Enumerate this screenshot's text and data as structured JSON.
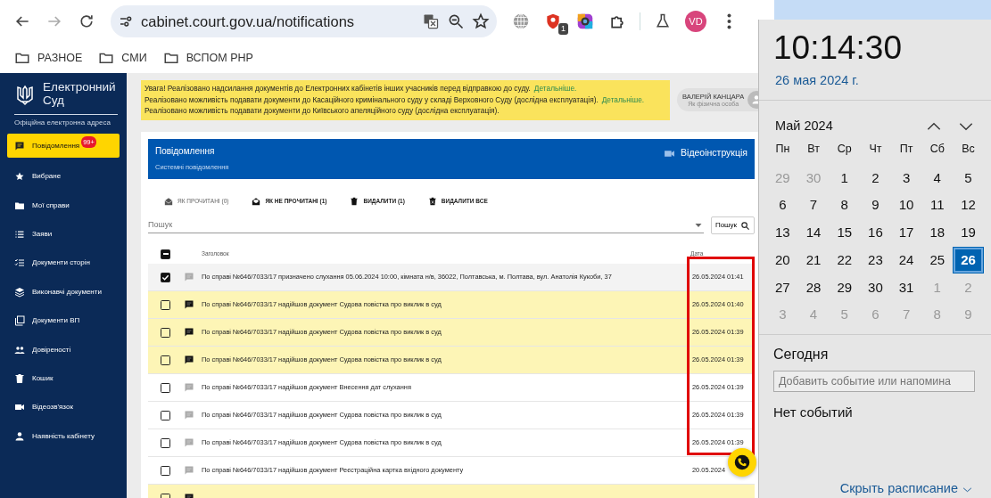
{
  "browser": {
    "url": "cabinet.court.gov.ua/notifications",
    "extension_badge": "1",
    "profile_initials": "VD",
    "bookmarks": [
      {
        "label": "РАЗНОЕ"
      },
      {
        "label": "СМИ"
      },
      {
        "label": "ВСПОМ PHP"
      }
    ]
  },
  "site": {
    "logo_title": "Електронний",
    "logo_title_2": "Суд",
    "logo_subtitle": "Офіційна електронна адреса"
  },
  "sidebar": {
    "items": [
      {
        "label": "Повідомлення",
        "kind": "message",
        "selected": true,
        "badge": "99+"
      },
      {
        "label": "Вибране",
        "kind": "star",
        "selected": false
      },
      {
        "label": "Мої справи",
        "kind": "folder",
        "selected": false
      },
      {
        "label": "Заяви",
        "kind": "list",
        "selected": false
      },
      {
        "label": "Документи сторін",
        "kind": "checklist",
        "selected": false
      },
      {
        "label": "Виконавчі документи",
        "kind": "layers",
        "selected": false
      },
      {
        "label": "Документи ВП",
        "kind": "copy",
        "selected": false
      },
      {
        "label": "Довіреності",
        "kind": "people",
        "selected": false
      },
      {
        "label": "Кошик",
        "kind": "trash",
        "selected": false
      },
      {
        "label": "Відеозв'язок",
        "kind": "video",
        "selected": false
      },
      {
        "label": "Наявність кабінету",
        "kind": "person",
        "selected": false
      }
    ]
  },
  "notice": {
    "lines": [
      {
        "text": "Увага! Реалізовано надсилання документів до Електронних кабінетів інших учасників перед відправкою до суду.",
        "link": "Детальніше."
      },
      {
        "text": "Реалізовано можливість подавати документи до Касаційного кримінального суду у складі Верховного Суду (дослідна експлуатація).",
        "link": "Детальніше."
      },
      {
        "text": "Реалізовано можливість подавати документи до Київського апеляційного суду (дослідна експлуатація)."
      }
    ]
  },
  "user": {
    "name": "ВАЛЕРІЙ КАНЦАРА",
    "role": "Як фізична особа"
  },
  "panel": {
    "title": "Повідомлення",
    "subtitle": "Системні повідомлення",
    "video_link": "Відеоінструкція"
  },
  "actions": [
    {
      "label": "ЯК ПРОЧИТАНІ (0)",
      "kind": "mailopen",
      "disabled": true
    },
    {
      "label": "ЯК НЕ ПРОЧИТАНІ (1)",
      "kind": "mail",
      "disabled": false
    },
    {
      "label": "ВИДАЛИТИ (1)",
      "kind": "trash",
      "disabled": false
    },
    {
      "label": "ВИДАЛИТИ ВСЕ",
      "kind": "trashall",
      "disabled": false
    }
  ],
  "search": {
    "placeholder": "Пошук",
    "button": "Пошук"
  },
  "table": {
    "select_all_indeterminate": true,
    "columns": [
      "Заголовок",
      "Дата"
    ],
    "rows": [
      {
        "checked": true,
        "unread": false,
        "highlighted": true,
        "title": "По справі №646/7033/17 призначено слухання 05.06.2024 10:00, кімната н/в, 36022, Полтавська, м. Полтава, вул. Анатолія Кукоби, 37",
        "date": "26.05.2024 01:41"
      },
      {
        "checked": false,
        "unread": true,
        "highlighted": true,
        "title": "По справі №646/7033/17 надійшов документ Судова повістка про виклик в суд",
        "date": "26.05.2024 01:40"
      },
      {
        "checked": false,
        "unread": true,
        "highlighted": true,
        "title": "По справі №646/7033/17 надійшов документ Судова повістка про виклик в суд",
        "date": "26.05.2024 01:39"
      },
      {
        "checked": false,
        "unread": true,
        "highlighted": true,
        "title": "По справі №646/7033/17 надійшов документ Судова повістка про виклик в суд",
        "date": "26.05.2024 01:39"
      },
      {
        "checked": false,
        "unread": false,
        "highlighted": true,
        "title": "По справі №646/7033/17 надійшов документ Внесення дат слухання",
        "date": "26.05.2024 01:39"
      },
      {
        "checked": false,
        "unread": false,
        "highlighted": true,
        "title": "По справі №646/7033/17 надійшов документ Судова повістка про виклик в суд",
        "date": "26.05.2024 01:39"
      },
      {
        "checked": false,
        "unread": false,
        "highlighted": true,
        "title": "По справі №646/7033/17 надійшов документ Судова повістка про виклик в суд",
        "date": "26.05.2024 01:39"
      },
      {
        "checked": false,
        "unread": false,
        "highlighted": false,
        "title": "По справі №646/7033/17 надійшов документ Реєстраційна картка вхідного документу",
        "date": "20.05.2024"
      },
      {
        "checked": false,
        "unread": true,
        "highlighted": false
      }
    ]
  },
  "clock": {
    "time": "10:14:30",
    "date": "26 мая 2024 г."
  },
  "calendar": {
    "month": "Май 2024",
    "weekdays": [
      "Пн",
      "Вт",
      "Ср",
      "Чт",
      "Пт",
      "Сб",
      "Вс"
    ],
    "days": [
      {
        "label": "29",
        "other_month": true,
        "selected": false
      },
      {
        "label": "30",
        "other_month": true,
        "selected": false
      },
      {
        "label": "1",
        "other_month": false,
        "selected": false
      },
      {
        "label": "2",
        "other_month": false,
        "selected": false
      },
      {
        "label": "3",
        "other_month": false,
        "selected": false
      },
      {
        "label": "4",
        "other_month": false,
        "selected": false
      },
      {
        "label": "5",
        "other_month": false,
        "selected": false
      },
      {
        "label": "6",
        "other_month": false,
        "selected": false
      },
      {
        "label": "7",
        "other_month": false,
        "selected": false
      },
      {
        "label": "8",
        "other_month": false,
        "selected": false
      },
      {
        "label": "9",
        "other_month": false,
        "selected": false
      },
      {
        "label": "10",
        "other_month": false,
        "selected": false
      },
      {
        "label": "11",
        "other_month": false,
        "selected": false
      },
      {
        "label": "12",
        "other_month": false,
        "selected": false
      },
      {
        "label": "13",
        "other_month": false,
        "selected": false
      },
      {
        "label": "14",
        "other_month": false,
        "selected": false
      },
      {
        "label": "15",
        "other_month": false,
        "selected": false
      },
      {
        "label": "16",
        "other_month": false,
        "selected": false
      },
      {
        "label": "17",
        "other_month": false,
        "selected": false
      },
      {
        "label": "18",
        "other_month": false,
        "selected": false
      },
      {
        "label": "19",
        "other_month": false,
        "selected": false
      },
      {
        "label": "20",
        "other_month": false,
        "selected": false
      },
      {
        "label": "21",
        "other_month": false,
        "selected": false
      },
      {
        "label": "22",
        "other_month": false,
        "selected": false
      },
      {
        "label": "23",
        "other_month": false,
        "selected": false
      },
      {
        "label": "24",
        "other_month": false,
        "selected": false
      },
      {
        "label": "25",
        "other_month": false,
        "selected": false
      },
      {
        "label": "26",
        "other_month": false,
        "selected": true
      },
      {
        "label": "27",
        "other_month": false,
        "selected": false
      },
      {
        "label": "28",
        "other_month": false,
        "selected": false
      },
      {
        "label": "29",
        "other_month": false,
        "selected": false
      },
      {
        "label": "30",
        "other_month": false,
        "selected": false
      },
      {
        "label": "31",
        "other_month": false,
        "selected": false
      },
      {
        "label": "1",
        "other_month": true,
        "selected": false
      },
      {
        "label": "2",
        "other_month": true,
        "selected": false
      },
      {
        "label": "3",
        "other_month": true,
        "selected": false
      },
      {
        "label": "4",
        "other_month": true,
        "selected": false
      },
      {
        "label": "5",
        "other_month": true,
        "selected": false
      },
      {
        "label": "6",
        "other_month": true,
        "selected": false
      },
      {
        "label": "7",
        "other_month": true,
        "selected": false
      },
      {
        "label": "8",
        "other_month": true,
        "selected": false
      },
      {
        "label": "9",
        "other_month": true,
        "selected": false
      }
    ]
  },
  "agenda": {
    "heading": "Сегодня",
    "placeholder": "Добавить событие или напомина",
    "empty": "Нет событий",
    "hide_link": "Скрыть расписание"
  }
}
